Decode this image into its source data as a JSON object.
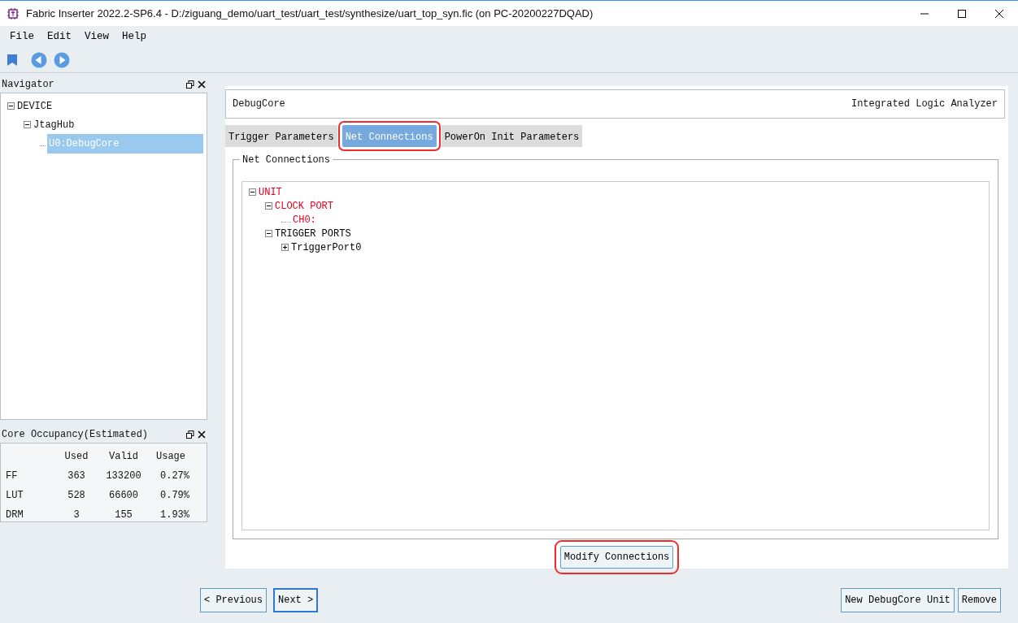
{
  "window": {
    "title": "Fabric Inserter 2022.2-SP6.4 - D:/ziguang_demo/uart_test/uart_test/synthesize/uart_top_syn.fic (on PC-20200227DQAD)"
  },
  "menu": [
    "File",
    "Edit",
    "View",
    "Help"
  ],
  "navigator": {
    "title": "Navigator",
    "tree": [
      {
        "label": "DEVICE",
        "expanded": true,
        "selected": false,
        "children": [
          {
            "label": "JtagHub",
            "expanded": true,
            "selected": false,
            "children": [
              {
                "label": "U0:DebugCore",
                "selected": true
              }
            ]
          }
        ]
      }
    ]
  },
  "occupancy": {
    "title": "Core Occupancy(Estimated)",
    "columns": [
      "",
      "Used",
      "Valid",
      "Usage"
    ],
    "rows": [
      [
        "FF",
        "363",
        "133200",
        "0.27%"
      ],
      [
        "LUT",
        "528",
        "66600",
        "0.79%"
      ],
      [
        "DRM",
        "3",
        "155",
        "1.93%"
      ]
    ]
  },
  "header": {
    "left": "DebugCore",
    "right": "Integrated Logic Analyzer"
  },
  "tabs": [
    {
      "label": "Trigger Parameters",
      "selected": false,
      "highlighted": false
    },
    {
      "label": "Net Connections",
      "selected": true,
      "highlighted": true
    },
    {
      "label": "PowerOn Init Parameters",
      "selected": false,
      "highlighted": false
    }
  ],
  "group": {
    "title": "Net Connections",
    "tree": [
      {
        "label": "UNIT",
        "color": "#e0001b",
        "expanded": true,
        "children": [
          {
            "label": "CLOCK PORT",
            "color": "#e0001b",
            "expanded": true,
            "children": [
              {
                "label": "CH0:",
                "color": "#e0001b"
              }
            ]
          },
          {
            "label": "TRIGGER PORTS",
            "color": "#000000",
            "expanded": true,
            "children": [
              {
                "label": "TriggerPort0",
                "color": "#000000",
                "expanded": false
              }
            ]
          }
        ]
      }
    ]
  },
  "modify_button": {
    "label": "Modify Connections",
    "highlighted": true
  },
  "nav_buttons": [
    {
      "label": "< Previous",
      "focused": false
    },
    {
      "label": "Next >",
      "focused": true
    }
  ],
  "action_buttons": [
    "New DebugCore Unit",
    "Remove"
  ]
}
